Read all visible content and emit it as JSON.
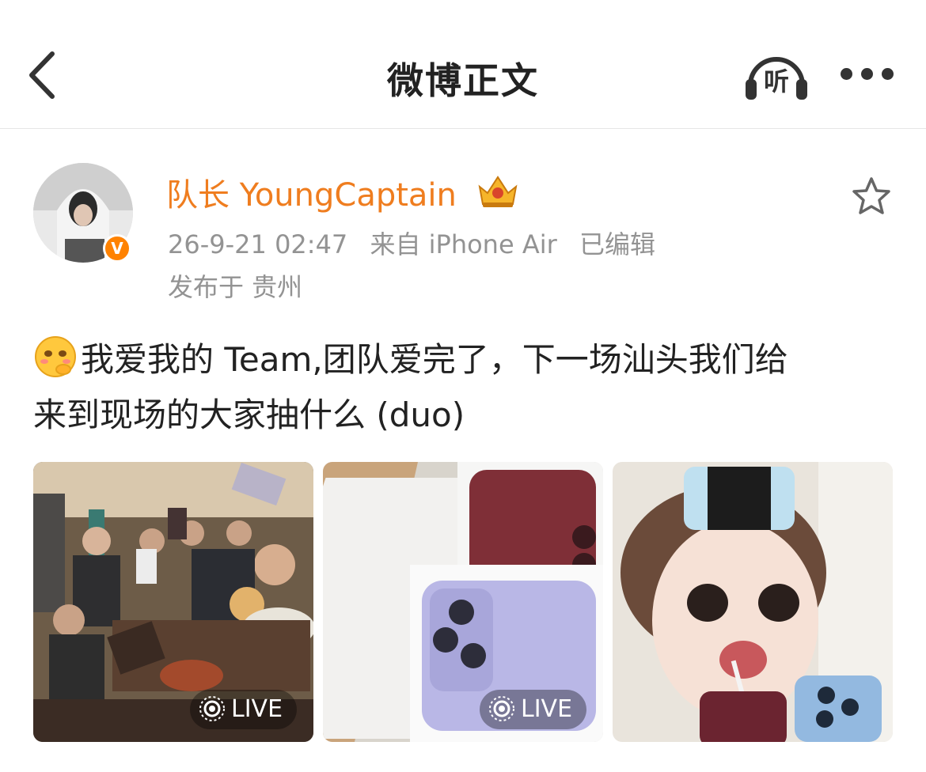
{
  "header": {
    "back_icon": "chevron-left-icon",
    "title": "微博正文",
    "listen_label": "听",
    "listen_icon": "headphones-icon",
    "more_icon": "more-dots-icon"
  },
  "post": {
    "author": {
      "name": "队长 YoungCaptain",
      "verified_badge": "V",
      "vip_icon": "crown-badge-icon",
      "avatar_icon": "avatar-photo"
    },
    "time": "26-9-21 02:47",
    "source": "来自 iPhone Air",
    "edited": "已编辑",
    "location": "发布于 贵州",
    "favorite_icon": "star-outline-icon",
    "text_line1": "我爱我的 Team,团队爱完了，下一场汕头我们给",
    "text_line2": "来到现场的大家抽什么 (duo)",
    "emoji_icon": "shy-emoji-icon",
    "images": [
      {
        "type": "live-photo",
        "live_label": "LIVE",
        "description_icon": "group-photo"
      },
      {
        "type": "live-photo",
        "live_label": "LIVE",
        "description_icon": "phone-boxes-photo"
      },
      {
        "type": "photo",
        "live_label": "",
        "description_icon": "selfie-filter-photo"
      }
    ]
  },
  "colors": {
    "username": "#ef7d1f",
    "verify": "#ff8200",
    "meta": "#939393",
    "text": "#222222"
  }
}
